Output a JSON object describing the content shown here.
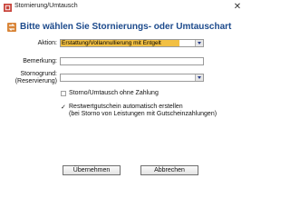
{
  "window": {
    "title": "Stornierung/Umtausch",
    "close_glyph": "✕"
  },
  "heading": "Bitte wählen Sie Stornierungs- oder Umtauschart",
  "form": {
    "aktion": {
      "label": "Aktion:",
      "selected": "Erstattung/Vollannullierung mit Entgelt",
      "highlight_color": "#f2c043"
    },
    "bemerkung": {
      "label": "Bemerkung:",
      "value": ""
    },
    "stornogrund": {
      "label_line1": "Stornogrund:",
      "label_line2": "(Reservierung)",
      "selected": ""
    },
    "storno_ohne_zahlung": {
      "label": "Storno/Umtausch ohne Zahlung",
      "checked": false
    },
    "restwertgutschein": {
      "label_line1": "Restwertgutschein automatisch erstellen",
      "label_line2": "(bei Storno von Leistungen mit Gutscheinzahlungen)",
      "checked": true,
      "check_glyph": "✓"
    }
  },
  "buttons": {
    "ok": "Übernehmen",
    "cancel": "Abbrechen"
  },
  "icons": {
    "title_icon": "app-ticket-icon",
    "heading_icon": "exchange-icon"
  }
}
